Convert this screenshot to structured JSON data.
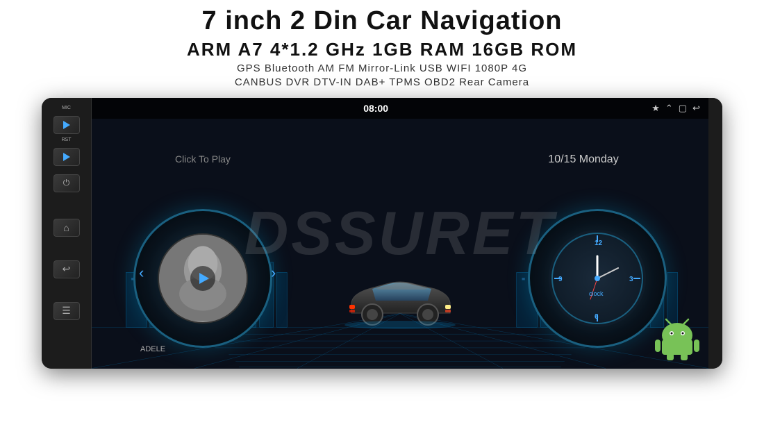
{
  "header": {
    "main_title": "7 inch 2 Din Car Navigation",
    "specs": "ARM A7 4*1.2 GHz    1GB RAM    16GB ROM",
    "features_line1": "GPS  Bluetooth  AM  FM  Mirror-Link  USB  WIFI  1080P  4G",
    "features_line2": "CANBUS   DVR   DTV-IN   DAB+   TPMS   OBD2   Rear Camera"
  },
  "device": {
    "left_panel": {
      "mic_label": "MIC",
      "rst_label": "RST"
    },
    "screen": {
      "status_bar": {
        "time": "08:00",
        "bluetooth_icon": "bluetooth",
        "expand_icon": "⌃",
        "window_icon": "▢",
        "back_icon": "↩"
      },
      "watermark": "DSSURET",
      "click_to_play": "Click To Play",
      "date": "10/15 Monday",
      "music_label": "ADELE",
      "clock_label": "clock",
      "clock_numbers": [
        "12",
        "3",
        "6",
        "9"
      ]
    }
  }
}
